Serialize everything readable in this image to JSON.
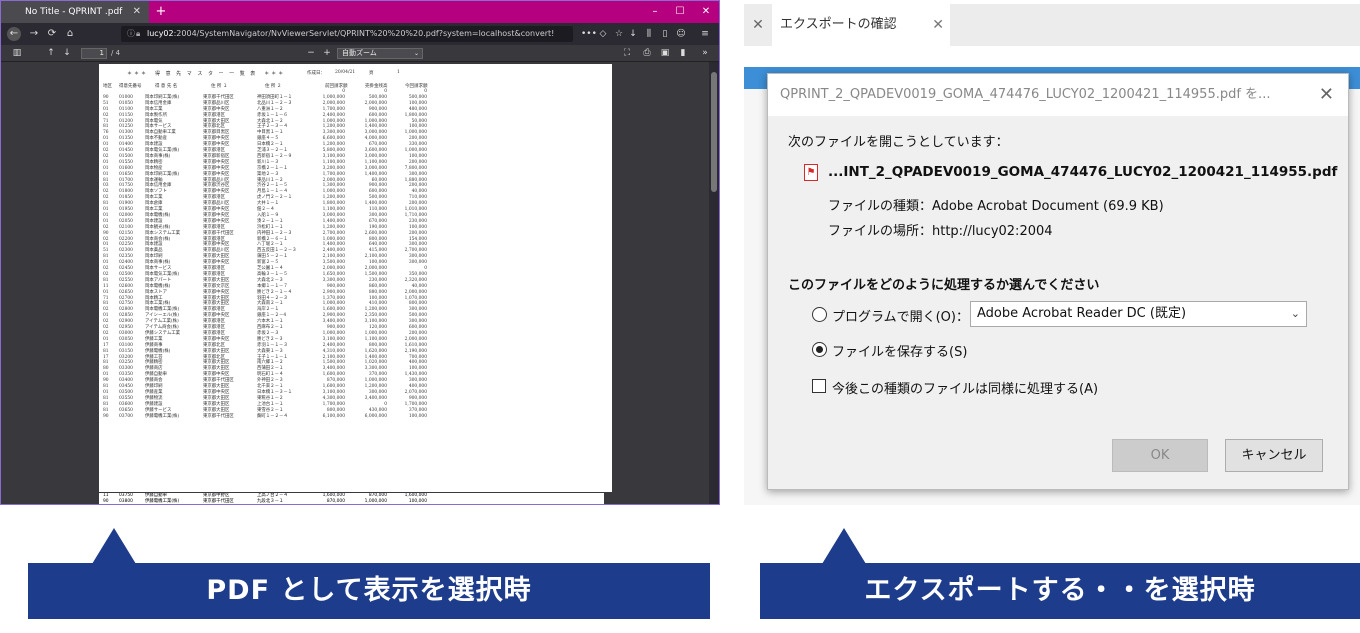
{
  "left": {
    "tab_title": "No Title - QPRINT .pdf",
    "tab_close": "✕",
    "new_tab": "+",
    "window_min": "–",
    "window_max": "☐",
    "window_close": "✕",
    "url_host": "lucy02",
    "url_rest": ":2004/SystemNavigator/NvViewerServlet/QPRINT%20%20%20.pdf?system=localhost&convert!",
    "url_dots": "•••",
    "page_current": "1",
    "page_total": "/ 4",
    "zoom_value": "自動ズーム",
    "zoom_minus": "−",
    "zoom_plus": "+",
    "report": {
      "title": "＊＊＊　得 意 先 マ ス タ ー 一 覧 表　＊＊＊",
      "created_label": "作成日：",
      "created_date": "20/04/21",
      "page_label": "頁",
      "page_no": "1",
      "col_sort": "地区",
      "col_code": "得意先番号",
      "col_name": "得 意 先 名",
      "col_addr1": "住 所 １",
      "col_addr2": "住 所 ２",
      "col_prev": "前回請求額",
      "col_recv": "売掛金残高",
      "col_curr": "今回請求額",
      "rows": [
        [
          "",
          "",
          "",
          "",
          "",
          "0",
          "0",
          "0"
        ],
        [
          "90",
          "01000",
          "岡本印刷工業(株)",
          "東京都千代田区",
          "神田須田町１－１",
          "1,000,000",
          "500,000",
          "500,000"
        ],
        [
          "51",
          "01050",
          "岡本信用金庫",
          "東京都品川区",
          "北品川１－２－３",
          "2,000,000",
          "2,000,000",
          "100,000"
        ],
        [
          "01",
          "01100",
          "岡本工業",
          "東京都中央区",
          "八重洲１－２",
          "1,700,000",
          "900,000",
          "480,000"
        ],
        [
          "02",
          "01150",
          "岡本製作所",
          "東京都港区",
          "赤坂１－１－６",
          "2,400,000",
          "600,000",
          "1,800,000"
        ],
        [
          "71",
          "01200",
          "岡本電気",
          "東京都大田区",
          "大森北１－２",
          "1,000,000",
          "1,000,000",
          "50,000"
        ],
        [
          "81",
          "01250",
          "岡本サービス",
          "東京都北区",
          "王子２－３－４",
          "1,200,000",
          "1,400,000",
          "100,000"
        ],
        [
          "76",
          "01300",
          "岡本自動車工業",
          "東京都目黒区",
          "中目黒１－１",
          "3,300,000",
          "3,000,000",
          "1,000,000"
        ],
        [
          "01",
          "01350",
          "岡本不動産",
          "東京都中央区",
          "銀座４－５",
          "6,600,000",
          "4,000,000",
          "200,000"
        ],
        [
          "01",
          "01400",
          "岡本建設",
          "東京都中央区",
          "日本橋２－１",
          "1,200,000",
          "670,000",
          "330,000"
        ],
        [
          "02",
          "01450",
          "岡本電気工業(株)",
          "東京都港区",
          "芝浦３－２－１",
          "5,800,000",
          "3,600,000",
          "1,000,000"
        ],
        [
          "02",
          "01500",
          "岡本商事(株)",
          "東京都新宿区",
          "西新宿１－２－９",
          "3,100,000",
          "3,000,000",
          "100,000"
        ],
        [
          "01",
          "01550",
          "岡本精密",
          "東京都中央区",
          "新川１－３",
          "1,100,000",
          "1,100,000",
          "200,000"
        ],
        [
          "01",
          "01600",
          "岡本物産",
          "東京都中央区",
          "京橋２－１－１",
          "3,200,000",
          "3,000,000",
          "7,800,000"
        ],
        [
          "01",
          "01650",
          "岡本印刷工業(株)",
          "東京都中央区",
          "築地２－３",
          "1,700,000",
          "1,400,000",
          "300,000"
        ],
        [
          "81",
          "01700",
          "岡本運輸",
          "東京都品川区",
          "東品川１－２",
          "2,000,000",
          "60,000",
          "1,880,000"
        ],
        [
          "03",
          "01750",
          "岡本信用金庫",
          "東京都渋谷区",
          "渋谷２－１－５",
          "1,300,000",
          "900,000",
          "200,000"
        ],
        [
          "02",
          "01800",
          "岡本ソフト",
          "東京都中央区",
          "月島１－１－４",
          "1,000,000",
          "600,000",
          "40,000"
        ],
        [
          "02",
          "01850",
          "岡本工業",
          "東京都港区",
          "虎ノ門２－２－１",
          "1,200,000",
          "500,000",
          "710,000"
        ],
        [
          "81",
          "01900",
          "岡本倉庫",
          "東京都品川区",
          "大井１－１",
          "1,800,000",
          "1,400,000",
          "200,000"
        ],
        [
          "01",
          "01950",
          "岡本工業",
          "東京都中央区",
          "佃２－４",
          "1,100,000",
          "110,000",
          "1,010,000"
        ],
        [
          "01",
          "02000",
          "岡本電機(株)",
          "東京都中央区",
          "入船１－９",
          "3,000,000",
          "300,000",
          "1,710,000"
        ],
        [
          "01",
          "02050",
          "岡本建設",
          "東京都中央区",
          "湊２－１－１",
          "1,400,000",
          "670,000",
          "230,000"
        ],
        [
          "02",
          "02100",
          "岡本観光(株)",
          "東京都港区",
          "浜松町１－１",
          "1,200,000",
          "190,000",
          "100,000"
        ],
        [
          "90",
          "02150",
          "岡本システム工業",
          "東京都千代田区",
          "内神田１－２－３",
          "2,700,000",
          "2,600,000",
          "200,000"
        ],
        [
          "02",
          "02200",
          "岡本商会(株)",
          "東京都港区",
          "新橋２－６－１",
          "1,000,000",
          "800,000",
          "154,000"
        ],
        [
          "01",
          "02250",
          "岡本建設",
          "東京都中央区",
          "八丁堀２－１",
          "1,400,000",
          "640,000",
          "300,000"
        ],
        [
          "51",
          "02300",
          "岡本薬品",
          "東京都品川区",
          "西五反田１－２－３",
          "2,400,000",
          "415,000",
          "2,700,000"
        ],
        [
          "81",
          "02350",
          "岡本印刷",
          "東京都大田区",
          "蒲田５－２－１",
          "2,100,000",
          "2,100,000",
          "300,000"
        ],
        [
          "01",
          "02400",
          "岡本商事(株)",
          "東京都中央区",
          "新富２－５",
          "3,500,000",
          "100,000",
          "300,000"
        ],
        [
          "02",
          "02450",
          "岡本サービス",
          "東京都港区",
          "芝公園１－４",
          "2,000,000",
          "2,000,000",
          "0"
        ],
        [
          "02",
          "02500",
          "岡本電気工業(株)",
          "東京都港区",
          "高輪３－１－５",
          "1,650,000",
          "1,500,000",
          "350,000"
        ],
        [
          "81",
          "02550",
          "岡本アパート",
          "東京都大田区",
          "大森北２－３",
          "3,300,000",
          "230,000",
          "2,320,000"
        ],
        [
          "11",
          "02600",
          "岡本電機(株)",
          "東京都文京区",
          "本郷１－１－７",
          "900,000",
          "860,000",
          "40,000"
        ],
        [
          "01",
          "02650",
          "岡本ストア",
          "東京都中央区",
          "勝どき２－１－４",
          "2,900,000",
          "880,000",
          "2,000,000"
        ],
        [
          "71",
          "02700",
          "岡本精工",
          "東京都大田区",
          "羽田４－２－３",
          "1,370,000",
          "100,000",
          "1,070,000"
        ],
        [
          "81",
          "02750",
          "岡本工業(株)",
          "東京都大田区",
          "大森南２－１",
          "1,000,000",
          "410,000",
          "800,000"
        ],
        [
          "02",
          "02800",
          "岡本電機工業(株)",
          "東京都港区",
          "海岸２－１",
          "1,600,000",
          "1,200,000",
          "300,000"
        ],
        [
          "01",
          "02850",
          "アイシーエル(株)",
          "東京都中央区",
          "銀座１－２－4",
          "2,900,000",
          "2,350,000",
          "500,000"
        ],
        [
          "02",
          "02900",
          "アイテム工業(株)",
          "東京都港区",
          "六本木１－１",
          "3,400,000",
          "3,100,000",
          "300,000"
        ],
        [
          "02",
          "02950",
          "アイテム商会(株)",
          "東京都港区",
          "西麻布２－１",
          "900,000",
          "120,000",
          "600,000"
        ],
        [
          "02",
          "03000",
          "伊藤システム工業",
          "東京都港区",
          "赤坂２－３",
          "1,000,000",
          "1,000,000",
          "200,000"
        ],
        [
          "01",
          "03050",
          "伊藤工業",
          "東京都中央区",
          "勝どき２－３",
          "3,100,000",
          "1,100,000",
          "2,000,000"
        ],
        [
          "17",
          "03100",
          "伊藤商事",
          "東京都北区",
          "赤羽１－１－３",
          "2,400,000",
          "800,000",
          "1,610,000"
        ],
        [
          "81",
          "03150",
          "伊藤電機(株)",
          "東京都大田区",
          "大森東１－３",
          "4,310,000",
          "1,620,000",
          "2,190,000"
        ],
        [
          "17",
          "03200",
          "伊藤工芸",
          "東京都北区",
          "王子１－１－１",
          "2,100,000",
          "1,400,000",
          "700,000"
        ],
        [
          "81",
          "03250",
          "伊藤精密",
          "東京都大田区",
          "南六郷１－２",
          "1,500,000",
          "1,020,000",
          "400,000"
        ],
        [
          "80",
          "03300",
          "伊藤商店",
          "東京都大田区",
          "西蒲田２－１",
          "3,400,000",
          "3,300,000",
          "100,000"
        ],
        [
          "01",
          "03350",
          "伊藤自動車",
          "東京都中央区",
          "明石町１－４",
          "1,600,000",
          "370,000",
          "1,430,000"
        ],
        [
          "90",
          "03400",
          "伊藤商会",
          "東京都千代田区",
          "外神田２－３",
          "870,000",
          "1,000,000",
          "300,000"
        ],
        [
          "81",
          "03450",
          "伊藤印刷",
          "東京都大田区",
          "北千束２－１",
          "1,600,000",
          "1,200,000",
          "400,000"
        ],
        [
          "01",
          "03500",
          "伊藤産業",
          "東京都中央区",
          "日本橋１－３－１",
          "3,100,000",
          "300,000",
          "2,070,000"
        ],
        [
          "81",
          "03550",
          "伊藤物流",
          "東京都大田区",
          "東糀谷１－２",
          "4,300,000",
          "3,400,000",
          "900,000"
        ],
        [
          "81",
          "03600",
          "伊藤建設",
          "東京都大田区",
          "上池台１－１",
          "1,700,000",
          "0",
          "1,700,000"
        ],
        [
          "81",
          "03650",
          "伊藤サービス",
          "東京都大田区",
          "東雪谷２－１",
          "800,000",
          "430,000",
          "370,000"
        ],
        [
          "90",
          "03700",
          "伊藤電機工業(株)",
          "東京都千代田区",
          "麹町１－２－４",
          "6,100,000",
          "6,000,000",
          "100,000"
        ]
      ],
      "page2_rows": [
        [
          "11",
          "03750",
          "伊藤自動車",
          "東京都中野区",
          "上高ノ台２－４",
          "1,600,000",
          "870,000",
          "1,600,000"
        ],
        [
          "90",
          "03800",
          "伊藤電機工業(株)",
          "東京都千代田区",
          "九段北３－１",
          "870,000",
          "1,000,000",
          "100,000"
        ]
      ]
    }
  },
  "right": {
    "tab_title": "エクスポートの確認",
    "tab_close": "✕",
    "side_close": "✕",
    "dialog": {
      "title": "QPRINT_2_QPADEV0019_GOMA_474476_LUCY02_1200421_114955.pdf を...",
      "close": "✕",
      "opening_msg": "次のファイルを開こうとしています：",
      "file_name": "...INT_2_QPADEV0019_GOMA_474476_LUCY02_1200421_114955.pdf",
      "file_type": "ファイルの種類：Adobe Acrobat Document (69.9 KB)",
      "file_location": "ファイルの場所：http://lucy02:2004",
      "question": "このファイルをどのように処理するか選んでください",
      "open_with_label": "プログラムで開く(O)：",
      "open_with_app": "Adobe Acrobat Reader DC (既定)",
      "save_label": "ファイルを保存する(S)",
      "remember_label": "今後この種類のファイルは同様に処理する(A)",
      "ok": "OK",
      "cancel": "キャンセル"
    }
  },
  "captions": {
    "left": "PDF として表示を選択時",
    "right": "エクスポートする・・を選択時"
  },
  "colors": {
    "caption_bg": "#1e3c8c",
    "firefox_tabbar": "#b5007f",
    "toolbar": "#38383d"
  }
}
